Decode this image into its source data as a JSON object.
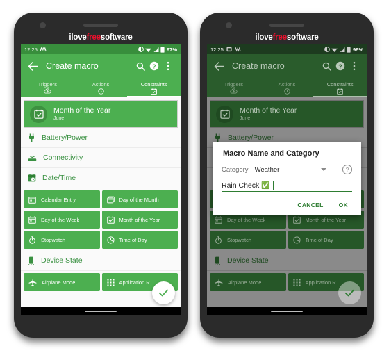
{
  "watermark": {
    "part1": "ilove",
    "part2": "free",
    "part3": "software"
  },
  "phones": [
    {
      "id": "left",
      "status": {
        "time": "12:25",
        "battery_pct": "97%"
      },
      "appbar": {
        "title": "Create macro",
        "back_icon": "arrow-left-icon",
        "search_icon": "search-icon",
        "help_icon": "help-circle-icon",
        "overflow_icon": "more-vertical-icon"
      },
      "tabs": [
        {
          "label": "Triggers",
          "icon": "cloud-upload-icon",
          "active": false
        },
        {
          "label": "Actions",
          "icon": "clock-icon",
          "active": false
        },
        {
          "label": "Constraints",
          "icon": "calendar-check-icon",
          "active": true
        }
      ],
      "selected_card": {
        "title": "Month of the Year",
        "subtitle": "June",
        "icon": "calendar-check-icon"
      },
      "sections": [
        {
          "label": "Battery/Power",
          "icon": "plug-icon",
          "chips": []
        },
        {
          "label": "Connectivity",
          "icon": "router-icon",
          "chips": []
        },
        {
          "label": "Date/Time",
          "icon": "calendar-clock-icon",
          "chips": [
            {
              "label": "Calendar Entry",
              "icon": "calendar-icon"
            },
            {
              "label": "Day of the Month",
              "icon": "calendar-days-icon"
            },
            {
              "label": "Day of the Week",
              "icon": "calendar-week-icon"
            },
            {
              "label": "Month of the Year",
              "icon": "calendar-check-icon"
            },
            {
              "label": "Stopwatch",
              "icon": "stopwatch-icon"
            },
            {
              "label": "Time of Day",
              "icon": "clock-icon"
            }
          ]
        },
        {
          "label": "Device State",
          "icon": "smartphone-icon",
          "chips": [
            {
              "label": "Airplane Mode",
              "icon": "airplane-icon"
            },
            {
              "label": "Application R",
              "icon": "grid-apps-icon"
            }
          ]
        }
      ],
      "fab": {
        "icon": "check-icon"
      },
      "dialog": null
    },
    {
      "id": "right",
      "status": {
        "time": "12:25",
        "battery_pct": "96%"
      },
      "appbar": {
        "title": "Create macro",
        "back_icon": "arrow-left-icon",
        "search_icon": "search-icon",
        "help_icon": "help-circle-icon",
        "overflow_icon": "more-vertical-icon"
      },
      "tabs": [
        {
          "label": "Triggers",
          "icon": "cloud-upload-icon",
          "active": false
        },
        {
          "label": "Actions",
          "icon": "clock-icon",
          "active": false
        },
        {
          "label": "Constraints",
          "icon": "calendar-check-icon",
          "active": true
        }
      ],
      "selected_card": {
        "title": "Month of the Year",
        "subtitle": "June",
        "icon": "calendar-check-icon"
      },
      "sections": [
        {
          "label": "Battery/Power",
          "icon": "plug-icon",
          "chips": []
        },
        {
          "label": "Connectivity",
          "icon": "router-icon",
          "chips": []
        },
        {
          "label": "Date/Time",
          "icon": "calendar-clock-icon",
          "chips": [
            {
              "label": "Calendar Entry",
              "icon": "calendar-icon"
            },
            {
              "label": "Day of the Month",
              "icon": "calendar-days-icon"
            },
            {
              "label": "Day of the Week",
              "icon": "calendar-week-icon"
            },
            {
              "label": "Month of the Year",
              "icon": "calendar-check-icon"
            },
            {
              "label": "Stopwatch",
              "icon": "stopwatch-icon"
            },
            {
              "label": "Time of Day",
              "icon": "clock-icon"
            }
          ]
        },
        {
          "label": "Device State",
          "icon": "smartphone-icon",
          "chips": [
            {
              "label": "Airplane Mode",
              "icon": "airplane-icon"
            },
            {
              "label": "Application R",
              "icon": "grid-apps-icon"
            }
          ]
        }
      ],
      "fab": {
        "icon": "check-icon"
      },
      "dialog": {
        "title": "Macro Name and Category",
        "category_label": "Category",
        "category_value": "Weather",
        "help_icon": "help-circle-icon",
        "name_value": "Rain Check",
        "name_emoji": "✅",
        "cancel_label": "CANCEL",
        "ok_label": "OK"
      }
    }
  ],
  "colors": {
    "green_primary": "#4CAF50",
    "green_dark": "#388E3C",
    "green_text": "#2E7D32",
    "bezel": "#2b2b2b",
    "screen_bg": "#fafafa",
    "brand_red": "#e8112d"
  }
}
